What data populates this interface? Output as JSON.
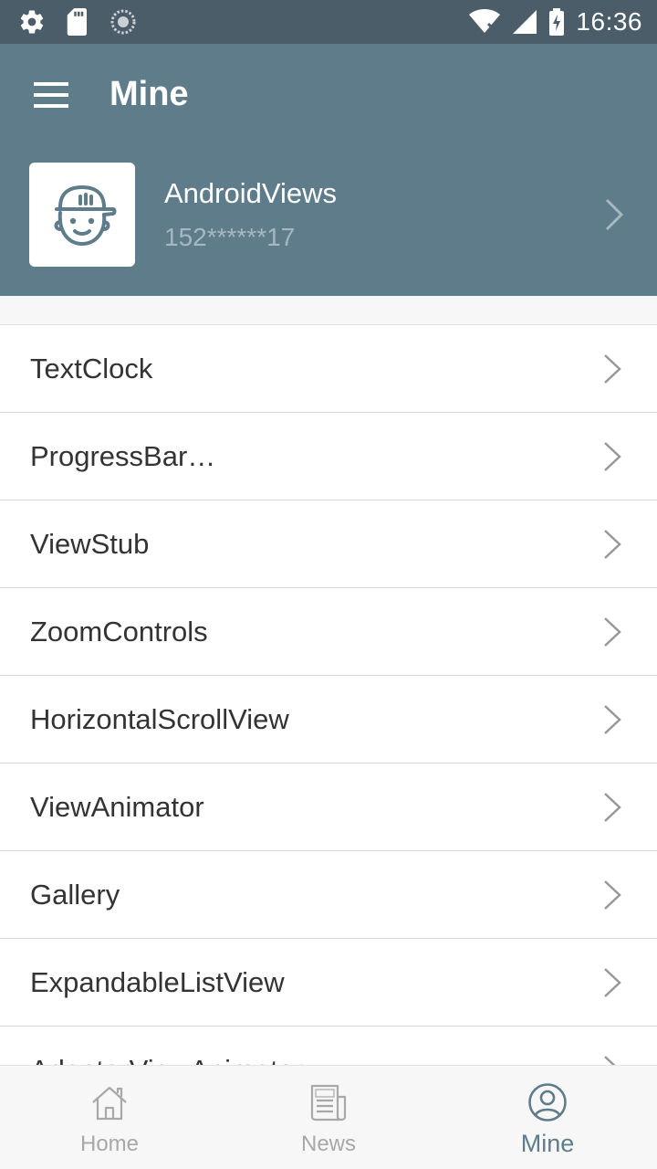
{
  "status_bar": {
    "time": "16:36",
    "left_icons": [
      "gear-icon",
      "sd-card-icon",
      "sync-icon"
    ],
    "right_icons": [
      "wifi-icon",
      "cell-signal-icon",
      "battery-charging-icon"
    ]
  },
  "header": {
    "title": "Mine",
    "profile": {
      "name": "AndroidViews",
      "phone": "152******17",
      "avatar_icon": "kid-face-cap-icon"
    }
  },
  "list": {
    "items": [
      {
        "label": "TextClock"
      },
      {
        "label": "ProgressBar…"
      },
      {
        "label": "ViewStub"
      },
      {
        "label": "ZoomControls"
      },
      {
        "label": "HorizontalScrollView"
      },
      {
        "label": "ViewAnimator"
      },
      {
        "label": "Gallery"
      },
      {
        "label": "ExpandableListView"
      },
      {
        "label": "AdapterViewAnimator"
      }
    ]
  },
  "bottom_nav": {
    "items": [
      {
        "label": "Home",
        "icon": "home-icon",
        "active": false
      },
      {
        "label": "News",
        "icon": "news-icon",
        "active": false
      },
      {
        "label": "Mine",
        "icon": "profile-icon",
        "active": true
      }
    ]
  },
  "colors": {
    "status_bar": "#4a5d68",
    "header": "#5f7c8a",
    "active_tab": "#5f7c8a",
    "inactive_tab": "#a8a8a8"
  }
}
